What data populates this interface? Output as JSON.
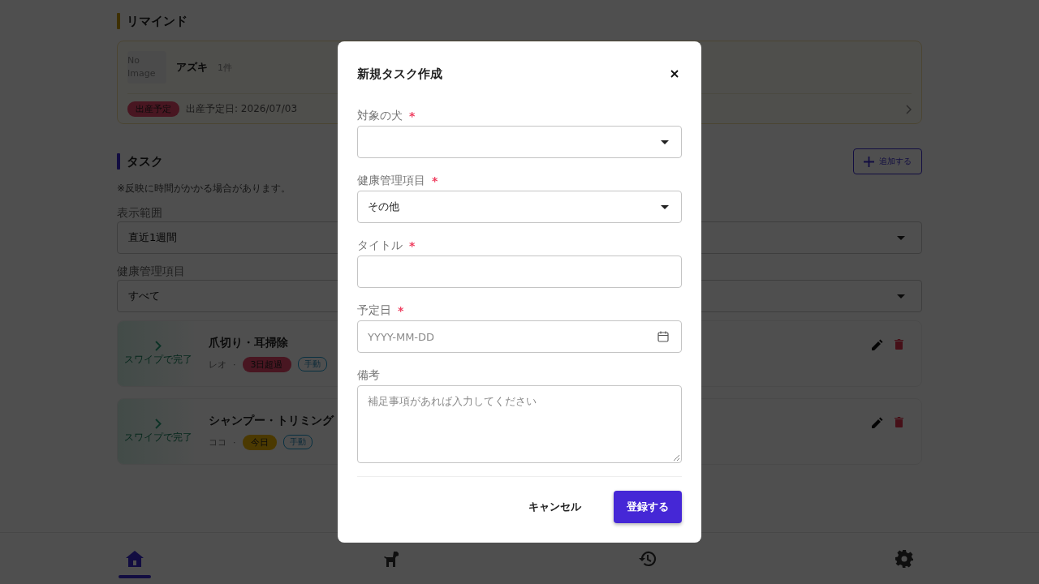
{
  "remind": {
    "title": "リマインド",
    "items": [
      {
        "image_placeholder": "No Image",
        "dog": "アズキ",
        "count": "1件",
        "tag": {
          "label": "出産予定",
          "kind": "birth"
        },
        "detail": "出産予定日: 2026/07/03"
      }
    ]
  },
  "tasks": {
    "title": "タスク",
    "add_button": "追加する",
    "note": "※反映に時間がかかる場合があります。",
    "filters": [
      {
        "label": "表示範囲",
        "value": "直近1週間"
      },
      {
        "label": "健康管理項目",
        "value": "すべて"
      }
    ],
    "items": [
      {
        "swipe_hint": "スワイプで完了",
        "title": "爪切り・耳掃除",
        "dog": "レオ",
        "separator": "·",
        "status": {
          "label": "3日超過",
          "kind": "overdue"
        },
        "source": "手動"
      },
      {
        "swipe_hint": "スワイプで完了",
        "title": "シャンプー・トリミング",
        "dog": "ココ",
        "separator": "·",
        "status": {
          "label": "今日",
          "kind": "today"
        },
        "source": "手動"
      }
    ]
  },
  "nav": [
    {
      "selected": true
    },
    {
      "selected": false
    },
    {
      "selected": false
    },
    {
      "selected": false
    }
  ],
  "modal": {
    "title": "新規タスク作成",
    "fields": [
      {
        "kind": "select",
        "label": "対象の犬",
        "marker": "*"
      },
      {
        "kind": "select",
        "label": "健康管理項目",
        "marker": "*",
        "value": "その他"
      },
      {
        "kind": "text",
        "label": "タイトル",
        "marker": "*"
      },
      {
        "kind": "date",
        "label": "予定日",
        "marker": "*",
        "placeholder": "YYYY-MM-DD"
      },
      {
        "kind": "textarea",
        "label": "備考",
        "placeholder": "補足事項があれば入力してください"
      }
    ],
    "buttons": [
      {
        "label": "キャンセル",
        "kind": "text"
      },
      {
        "label": "登録する",
        "kind": "primary"
      }
    ]
  }
}
